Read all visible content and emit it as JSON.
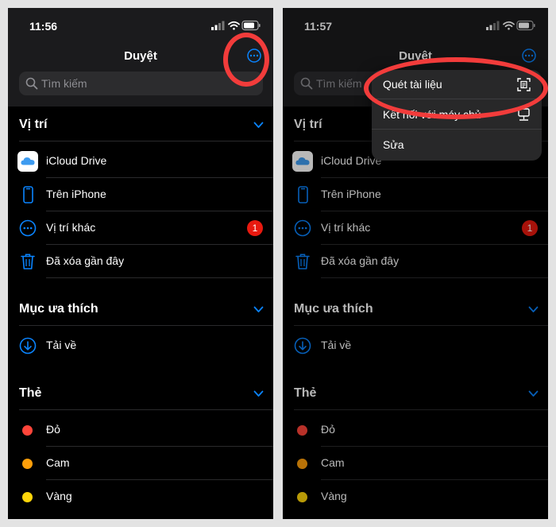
{
  "left": {
    "status_time": "11:56",
    "nav_title": "Duyệt",
    "search_placeholder": "Tìm kiếm",
    "locations_title": "Vị trí",
    "locations": [
      {
        "label": "iCloud Drive",
        "icon": "icloud-drive-icon"
      },
      {
        "label": "Trên iPhone",
        "icon": "iphone-icon"
      },
      {
        "label": "Vị trí khác",
        "icon": "more-circle-icon",
        "badge": "1"
      },
      {
        "label": "Đã xóa gần đây",
        "icon": "trash-icon"
      }
    ],
    "favorites_title": "Mục ưa thích",
    "favorites": [
      {
        "label": "Tải về",
        "icon": "download-icon"
      }
    ],
    "tags_title": "Thẻ",
    "tags": [
      {
        "label": "Đỏ",
        "color": "#ff453a"
      },
      {
        "label": "Cam",
        "color": "#ff9f0a"
      },
      {
        "label": "Vàng",
        "color": "#ffd60a"
      }
    ]
  },
  "right": {
    "status_time": "11:57",
    "nav_title": "Duyệt",
    "search_placeholder": "Tìm kiếm",
    "locations_title": "Vị trí",
    "locations": [
      {
        "label": "iCloud Drive",
        "icon": "icloud-drive-icon"
      },
      {
        "label": "Trên iPhone",
        "icon": "iphone-icon"
      },
      {
        "label": "Vị trí khác",
        "icon": "more-circle-icon",
        "badge": "1"
      },
      {
        "label": "Đã xóa gần đây",
        "icon": "trash-icon"
      }
    ],
    "favorites_title": "Mục ưa thích",
    "favorites": [
      {
        "label": "Tải về",
        "icon": "download-icon"
      }
    ],
    "tags_title": "Thẻ",
    "tags": [
      {
        "label": "Đỏ",
        "color": "#ff453a"
      },
      {
        "label": "Cam",
        "color": "#ff9f0a"
      },
      {
        "label": "Vàng",
        "color": "#ffd60a"
      }
    ],
    "menu": [
      {
        "label": "Quét tài liệu",
        "icon": "scan-document-icon"
      },
      {
        "label": "Kết nối với máy chủ",
        "icon": "server-icon"
      },
      {
        "label": "Sửa",
        "icon": ""
      }
    ]
  },
  "colors": {
    "accent": "#0a84ff",
    "highlight_ring": "#f23c3b",
    "badge": "#e8190f"
  }
}
